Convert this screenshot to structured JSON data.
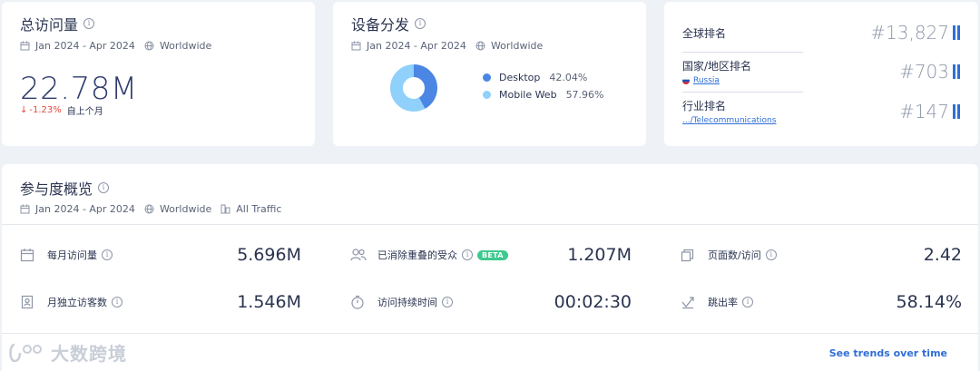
{
  "total_visits": {
    "title": "总访问量",
    "date_range": "Jan 2024 - Apr 2024",
    "region": "Worldwide",
    "value": "22.78M",
    "change": "-1.23%",
    "change_period": "自上个月"
  },
  "device_distribution": {
    "title": "设备分发",
    "date_range": "Jan 2024 - Apr 2024",
    "region": "Worldwide",
    "chart_data": {
      "type": "pie",
      "categories": [
        "Desktop",
        "Mobile Web"
      ],
      "values": [
        42.04,
        57.96
      ],
      "labels": [
        "42.04%",
        "57.96%"
      ],
      "colors": [
        "#4b86e4",
        "#8fd1fb"
      ]
    }
  },
  "ranks": {
    "global_label": "全球排名",
    "global_value": "#13,827",
    "country_label": "国家/地区排名",
    "country_link": "Russia",
    "country_value": "#703",
    "industry_label": "行业排名",
    "industry_link": ".../Telecommunications",
    "industry_value": "#147"
  },
  "engagement": {
    "title": "参与度概览",
    "date_range": "Jan 2024 - Apr 2024",
    "region": "Worldwide",
    "traffic": "All Traffic",
    "monthly_visits_label": "每月访问量",
    "monthly_visits_value": "5.696M",
    "dedup_audience_label": "已消除重叠的受众",
    "beta_badge": "BETA",
    "dedup_audience_value": "1.207M",
    "pages_per_visit_label": "页面数/访问",
    "pages_per_visit_value": "2.42",
    "unique_visitors_label": "月独立访客数",
    "unique_visitors_value": "1.546M",
    "visit_duration_label": "访问持续时间",
    "visit_duration_value": "00:02:30",
    "bounce_rate_label": "跳出率",
    "bounce_rate_value": "58.14%",
    "see_trends": "See trends over time"
  },
  "watermark": "大数跨境",
  "colors": {
    "accent": "#2f6ed6",
    "negative": "#e4473b",
    "beta": "#3ec98f"
  }
}
